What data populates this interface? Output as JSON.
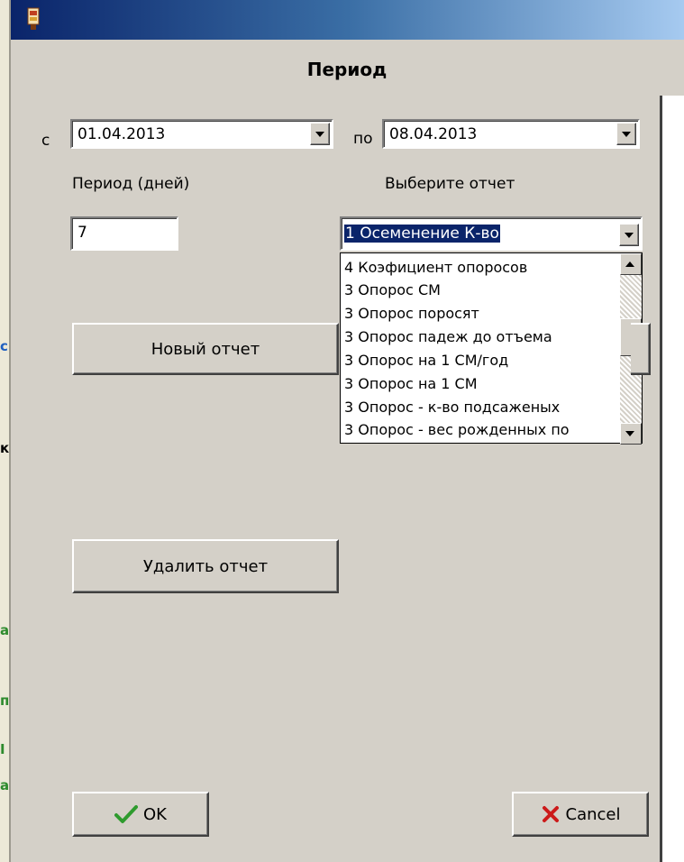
{
  "dialog": {
    "title": "Период",
    "from_label": "с",
    "from_date": "01.04.2013",
    "to_label": "по",
    "to_date": "08.04.2013",
    "period_label": "Период (дней)",
    "period_value": "7",
    "report_label": "Выберите отчет",
    "report_selected": "1 Осеменение К-во",
    "report_options": [
      "4 Коэфициент опоросов",
      "3 Опорос СМ",
      "3 Опорос поросят",
      "3 Опорос падеж до отъема",
      "3 Опорос на 1 СМ/год",
      "3 Опорос на 1 СМ",
      "3 Опорос - к-во подсаженых",
      "3 Опорос - вес рожденных по"
    ],
    "new_report_button": "Новый отчет",
    "delete_report_button": "Удалить отчет",
    "ok_button": "OK",
    "cancel_button": "Cancel"
  },
  "background_fragments": [
    "с",
    "к",
    "а",
    "п",
    "I",
    "а"
  ],
  "colors": {
    "titlebar": "#0a246a",
    "dialog_bg": "#d4d0c8",
    "ok_check": "#2e9b2e",
    "cancel_x": "#cc1a1a",
    "fragment_green": "#2e8b2e",
    "fragment_blue": "#2060c0"
  }
}
